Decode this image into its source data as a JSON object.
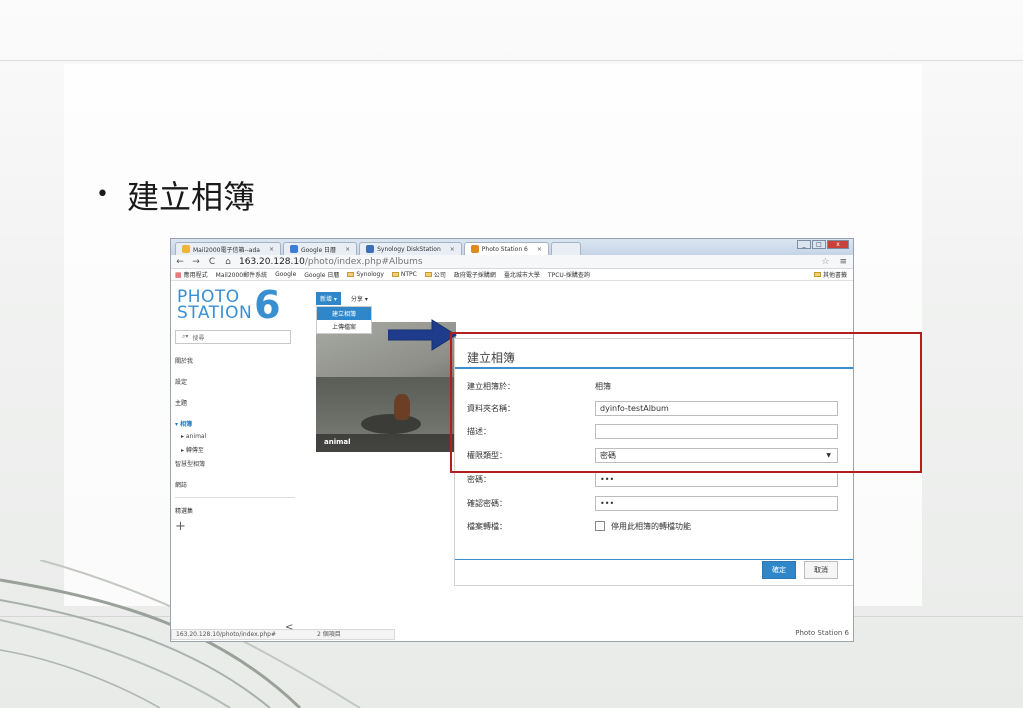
{
  "slide": {
    "bullet_glyph": "•",
    "heading": "建立相簿"
  },
  "browser": {
    "tabs": [
      {
        "label": "Mail2000電子信箱--ada",
        "active": false,
        "color": "#f0b43c"
      },
      {
        "label": "Google 日曆",
        "active": false,
        "color": "#3b7dd8"
      },
      {
        "label": "Synology DiskStation",
        "active": false,
        "color": "#3b6fb8"
      },
      {
        "label": "Photo Station 6",
        "active": true,
        "color": "#e08a1e"
      }
    ],
    "tab_close": "×",
    "nav": {
      "back": "←",
      "forward": "→",
      "reload": "C",
      "home": "⌂"
    },
    "url_host": "163.20.128.10",
    "url_path": "/photo/index.php#Albums",
    "bookmarks": [
      "應用程式",
      "Mail2000郵件系統",
      "Google",
      "Google 日曆",
      "Synology",
      "NTPC",
      "公司",
      "政府電子採購網",
      "臺北城市大學",
      "TPCU-採購查詢"
    ],
    "other_bookmarks": "其他書籤",
    "status_url": "163.20.128.10/photo/index.php#"
  },
  "app": {
    "logo_text_top": "PHOTO",
    "logo_text_bottom": "STATION",
    "logo_number": "6",
    "search_placeholder": "搜尋",
    "sidebar": {
      "about": "關於我",
      "settings": "設定",
      "theme": "主題",
      "albums": "▾ 相簿",
      "album_animal": "▸ animal",
      "shared": "▸ 轉傳至",
      "smart": "智慧型相簿",
      "blog": "網誌",
      "favorites": "精選集",
      "add": "+"
    },
    "toolbar": {
      "new": "新增 ▾",
      "share": "分享 ▾"
    },
    "dropdown": {
      "create": "建立相簿",
      "upload": "上傳檔案"
    },
    "thumb_caption": "animal",
    "footer_chevron": "<",
    "footer_count": "2 個項目",
    "footer_brand": "Photo Station 6"
  },
  "dialog": {
    "title": "建立相簿",
    "location_label": "建立相簿於：",
    "location_value": "相簿",
    "folder_label": "資料夾名稱：",
    "folder_value": "dyinfo-testAlbum",
    "desc_label": "描述：",
    "desc_value": "",
    "perm_label": "權限類型：",
    "perm_value": "密碼",
    "pwd_label": "密碼：",
    "pwd_value": "•••",
    "confirm_label": "確認密碼：",
    "confirm_value": "•••",
    "conv_label": "檔案轉檔：",
    "conv_option": "停用此相簿的轉檔功能",
    "ok": "確定",
    "cancel": "取消"
  }
}
